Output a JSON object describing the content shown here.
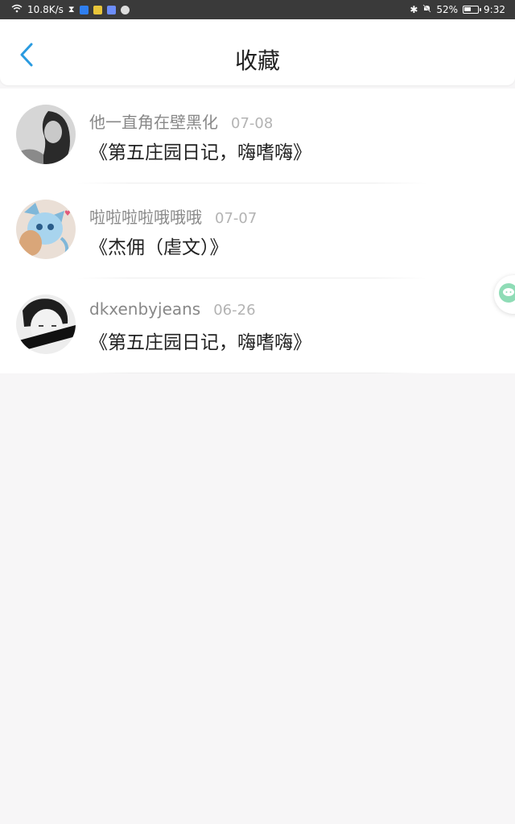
{
  "status_bar": {
    "net_speed": "10.8K/s",
    "battery": "52%",
    "time": "9:32"
  },
  "header": {
    "title": "收藏",
    "back_icon": "chevron-left-icon",
    "accent_color": "#2a9be0"
  },
  "favorites": [
    {
      "author": "他一直角在壁黑化",
      "date": "07-08",
      "title": "《第五庄园日记，嗨嗜嗨》"
    },
    {
      "author": "啦啦啦啦哦哦哦",
      "date": "07-07",
      "title": "《杰佣（虐文）》"
    },
    {
      "author": "dkxenbyjeans",
      "date": "06-26",
      "title": "《第五庄园日记，嗨嗜嗨》"
    }
  ],
  "floating_button": {
    "icon": "chat-bubble-icon",
    "color": "#8fdcb6"
  }
}
